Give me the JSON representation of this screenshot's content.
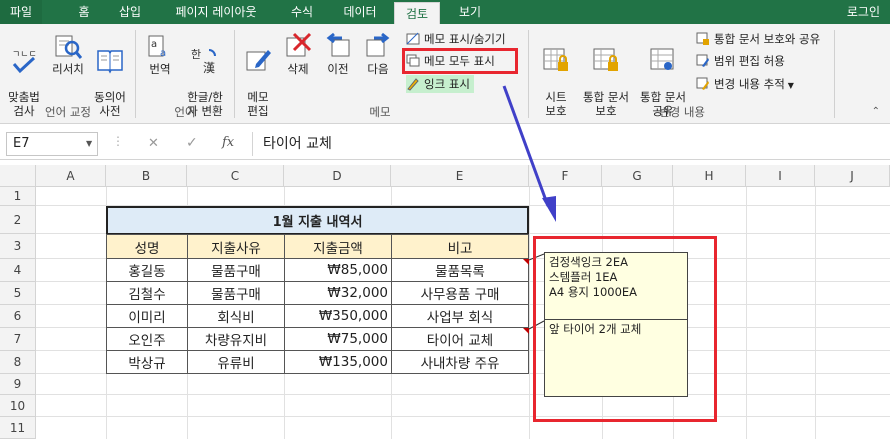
{
  "tabs": [
    {
      "label": "파일"
    },
    {
      "label": "홈"
    },
    {
      "label": "삽입"
    },
    {
      "label": "페이지 레이아웃"
    },
    {
      "label": "수식"
    },
    {
      "label": "데이터"
    },
    {
      "label": "검토"
    },
    {
      "label": "보기"
    }
  ],
  "login_label": "로그인",
  "ribbon": {
    "spell_label": "맞춤법\n검사",
    "research_label": "리서치",
    "thesaurus_label": "동의어\n사전",
    "translate_label": "번역",
    "hanja_label": "한글/한\n자 변환",
    "new_comment_label": "메모\n편집",
    "delete_label": "삭제",
    "prev_label": "이전",
    "next_label": "다음",
    "show_hide_label": "메모 표시/숨기기",
    "show_all_label": "메모 모두 표시",
    "show_ink_label": "잉크 표시",
    "protect_sheet_label": "시트\n보호",
    "protect_wb_label": "통합 문서\n보호",
    "share_wb_label": "통합 문서\n공유",
    "protect_share_label": "통합 문서 보호와 공유",
    "allow_edit_label": "범위 편집 허용",
    "track_changes_label": "변경 내용 추적",
    "groups": {
      "proofing": "언어 교정",
      "language": "언어",
      "comments": "메모",
      "changes": "변경 내용"
    }
  },
  "formula_bar": {
    "name_box": "E7",
    "cancel_icon": "✕",
    "enter_icon": "✓",
    "fx": "fx",
    "content": "타이어 교체"
  },
  "columns": [
    "A",
    "B",
    "C",
    "D",
    "E",
    "F",
    "G",
    "H",
    "I",
    "J"
  ],
  "rows": [
    "1",
    "2",
    "3",
    "4",
    "5",
    "6",
    "7",
    "8",
    "9",
    "10",
    "11"
  ],
  "sheet": {
    "title": "1월 지출 내역서",
    "headers": [
      "성명",
      "지출사유",
      "지출금액",
      "비고"
    ],
    "data": [
      [
        "홍길동",
        "물품구매",
        "₩85,000",
        "물품목록"
      ],
      [
        "김철수",
        "물품구매",
        "₩32,000",
        "사무용품 구매"
      ],
      [
        "이미리",
        "회식비",
        "₩350,000",
        "사업부 회식"
      ],
      [
        "오인주",
        "차량유지비",
        "₩75,000",
        "타이어 교체"
      ],
      [
        "박상규",
        "유류비",
        "₩135,000",
        "사내차량 주유"
      ]
    ]
  },
  "comments": [
    {
      "lines": [
        "검정색잉크 2EA",
        "스템플러 1EA",
        "A4 용지 1000EA"
      ]
    },
    {
      "lines": [
        "앞 타이어 2개 교체"
      ]
    }
  ],
  "colors": {
    "excel_green": "#217346",
    "highlight_red": "#e8262f",
    "arrow_blue": "#4040c8",
    "title_fill": "#deebf7",
    "header_fill": "#fff2cc",
    "comment_fill": "#ffffe1"
  }
}
